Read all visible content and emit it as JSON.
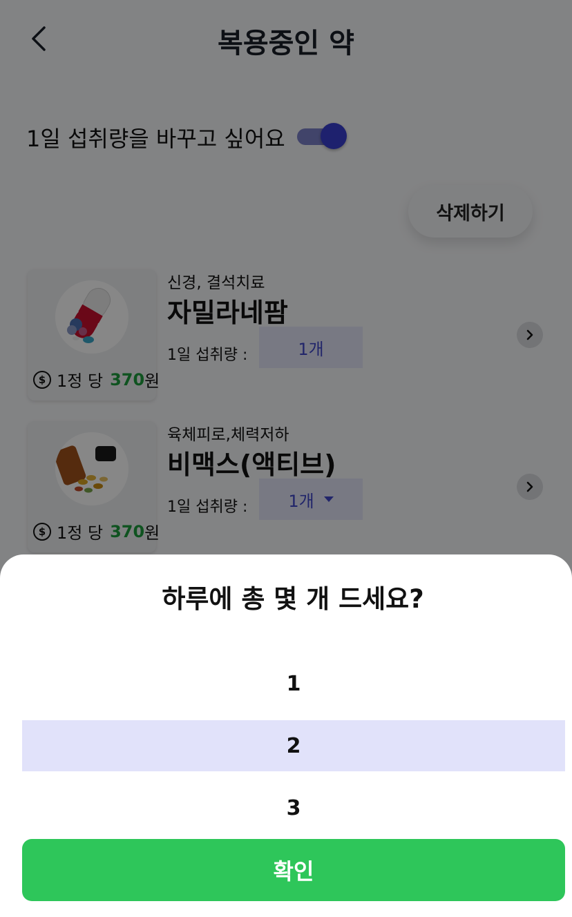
{
  "header": {
    "title": "복용중인 약"
  },
  "settings": {
    "toggle_label": "1일 섭취량을 바꾸고 싶어요",
    "toggle_on": true
  },
  "actions": {
    "delete_label": "삭제하기"
  },
  "medicines": [
    {
      "category": "신경, 결석치료",
      "name": "자밀라네팜",
      "dose_label": "1일 섭취량 :",
      "dose_value": "1개",
      "price_prefix": "1정 당",
      "price_amount": "370",
      "price_unit": "원"
    },
    {
      "category": "육체피로,체력저하",
      "name": "비맥스(액티브)",
      "dose_label": "1일 섭취량 :",
      "dose_value": "1개",
      "price_prefix": "1정 당",
      "price_amount": "370",
      "price_unit": "원"
    }
  ],
  "sheet": {
    "title": "하루에 총 몇 개 드세요?",
    "options": [
      "1",
      "2",
      "3"
    ],
    "selected": "2",
    "confirm_label": "확인"
  },
  "colors": {
    "accent": "#3a3fd0",
    "price": "#1e9e3e",
    "confirm": "#2ec65a",
    "selected_option": "#e1e2fa"
  }
}
